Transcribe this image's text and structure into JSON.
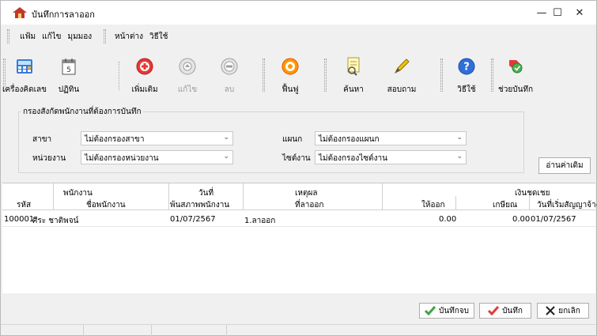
{
  "window": {
    "title": "บันทึกการลาออก"
  },
  "menu": {
    "items": [
      "แฟ้ม",
      "แก้ไข",
      "มุมมอง",
      "หน้าต่าง",
      "วิธีใช้"
    ]
  },
  "toolbar": {
    "calculator": "เครื่องคิดเลข",
    "calendar": "ปฏิทิน",
    "add": "เพิ่มเติม",
    "edit": "แก้ไข",
    "delete": "ลบ",
    "restore": "ฟื้นฟู",
    "search": "ค้นหา",
    "inquiry": "สอบถาม",
    "help": "วิธีใช้",
    "assist": "ช่วยบันทึก"
  },
  "filter": {
    "title": "กรองสังกัดพนักงานที่ต้องการบันทึก",
    "branch_label": "สาขา",
    "branch_value": "ไม่ต้องกรองสาขา",
    "dept_label": "แผนก",
    "dept_value": "ไม่ต้องกรองแผนก",
    "unit_label": "หน่วยงาน",
    "unit_value": "ไม่ต้องกรองหน่วยงาน",
    "worksite_label": "ไซต์งาน",
    "worksite_value": "ไม่ต้องกรองไซต์งาน",
    "read_old": "อ่านค่าเดิม"
  },
  "table": {
    "group_headers": {
      "employee": "พนักงาน",
      "date": "วันที่",
      "reason": "เหตุผล",
      "compensation": "เงินชดเชย"
    },
    "columns": [
      "รหัส",
      "ชื่อพนักงาน",
      "พ้นสภาพพนักงาน",
      "ที่ลาออก",
      "ให้ออก",
      "เกษียณ",
      "วันที่เริ่มสัญญาจ้าง"
    ],
    "rows": [
      {
        "code": "100001",
        "name": "ศีระ  ชาติพจน์",
        "end_date": "01/07/2567",
        "reason": "1.ลาออก",
        "dismiss": "0.00",
        "retire": "0.00",
        "contract_start": "01/07/2567"
      }
    ]
  },
  "actions": {
    "save_close": "บันทึกจบ",
    "save": "บันทึก",
    "cancel": "ยกเลิก"
  }
}
